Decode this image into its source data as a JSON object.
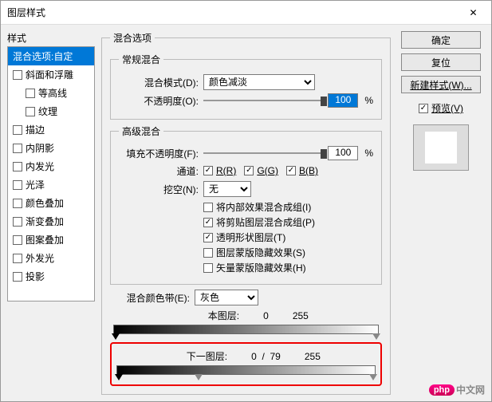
{
  "window": {
    "title": "图层样式"
  },
  "sidebar": {
    "label": "样式",
    "items": [
      {
        "label": "混合选项:自定",
        "selected": true,
        "checkbox": false,
        "indent": false
      },
      {
        "label": "斜面和浮雕",
        "selected": false,
        "checkbox": true,
        "indent": false
      },
      {
        "label": "等高线",
        "selected": false,
        "checkbox": true,
        "indent": true
      },
      {
        "label": "纹理",
        "selected": false,
        "checkbox": true,
        "indent": true
      },
      {
        "label": "描边",
        "selected": false,
        "checkbox": true,
        "indent": false
      },
      {
        "label": "内阴影",
        "selected": false,
        "checkbox": true,
        "indent": false
      },
      {
        "label": "内发光",
        "selected": false,
        "checkbox": true,
        "indent": false
      },
      {
        "label": "光泽",
        "selected": false,
        "checkbox": true,
        "indent": false
      },
      {
        "label": "颜色叠加",
        "selected": false,
        "checkbox": true,
        "indent": false
      },
      {
        "label": "渐变叠加",
        "selected": false,
        "checkbox": true,
        "indent": false
      },
      {
        "label": "图案叠加",
        "selected": false,
        "checkbox": true,
        "indent": false
      },
      {
        "label": "外发光",
        "selected": false,
        "checkbox": true,
        "indent": false
      },
      {
        "label": "投影",
        "selected": false,
        "checkbox": true,
        "indent": false
      }
    ]
  },
  "blending_options": {
    "legend": "混合选项",
    "general": {
      "legend": "常规混合",
      "blend_mode_label": "混合模式(D):",
      "blend_mode_value": "颜色减淡",
      "opacity_label": "不透明度(O):",
      "opacity_value": "100",
      "opacity_unit": "%"
    },
    "advanced": {
      "legend": "高级混合",
      "fill_opacity_label": "填充不透明度(F):",
      "fill_opacity_value": "100",
      "fill_opacity_unit": "%",
      "channels_label": "通道:",
      "channel_r": "R(R)",
      "channel_g": "G(G)",
      "channel_b": "B(B)",
      "knockout_label": "挖空(N):",
      "knockout_value": "无",
      "opts": [
        {
          "label": "将内部效果混合成组(I)",
          "checked": false
        },
        {
          "label": "将剪贴图层混合成组(P)",
          "checked": true
        },
        {
          "label": "透明形状图层(T)",
          "checked": true
        },
        {
          "label": "图层蒙版隐藏效果(S)",
          "checked": false
        },
        {
          "label": "矢量蒙版隐藏效果(H)",
          "checked": false
        }
      ]
    },
    "blend_if": {
      "label": "混合颜色带(E):",
      "value": "灰色",
      "this_layer_label": "本图层:",
      "this_layer_lo": "0",
      "this_layer_hi": "255",
      "under_layer_label": "下一图层:",
      "under_layer_lo": "0",
      "under_layer_mid": "79",
      "under_layer_hi": "255"
    }
  },
  "buttons": {
    "ok": "确定",
    "cancel": "复位",
    "new_style": "新建样式(W)...",
    "preview_label": "预览(V)"
  },
  "watermark": {
    "badge": "php",
    "text": "中文网"
  }
}
